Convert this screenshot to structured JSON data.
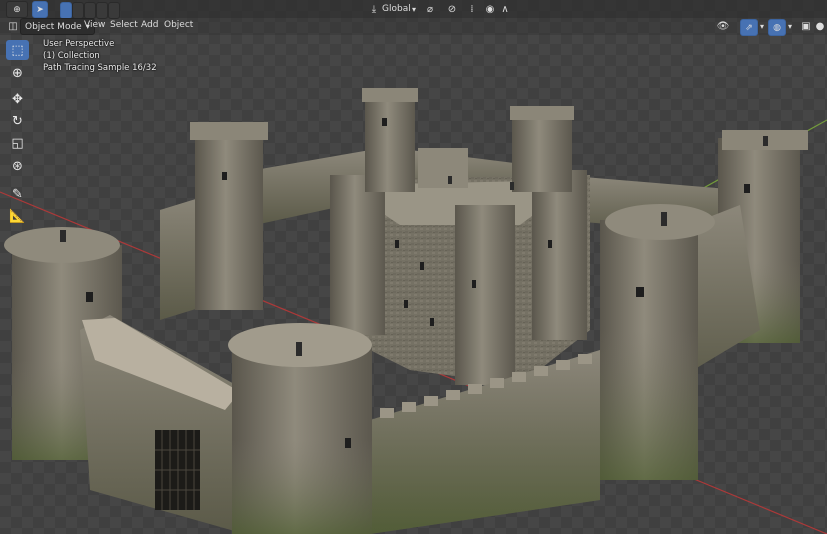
{
  "header": {
    "mode": "Object Mode",
    "menus": [
      "View",
      "Select",
      "Add",
      "Object"
    ],
    "transform_orientation": "Global"
  },
  "overlay": {
    "perspective": "User Perspective",
    "collection": "(1) Collection",
    "render_status": "Path Tracing Sample 16/32"
  },
  "toolbar": {
    "tools": [
      "select-box-icon",
      "cursor-icon",
      "move-icon",
      "rotate-icon",
      "scale-icon",
      "transform-icon",
      "annotate-icon",
      "measure-icon"
    ],
    "active_tool": "select-box-icon"
  },
  "colors": {
    "accent": "#4772b3",
    "x_axis": "#c83a3a",
    "y_axis": "#7ab03a",
    "stone": "#8c8678",
    "moss": "#5e6a3a"
  }
}
